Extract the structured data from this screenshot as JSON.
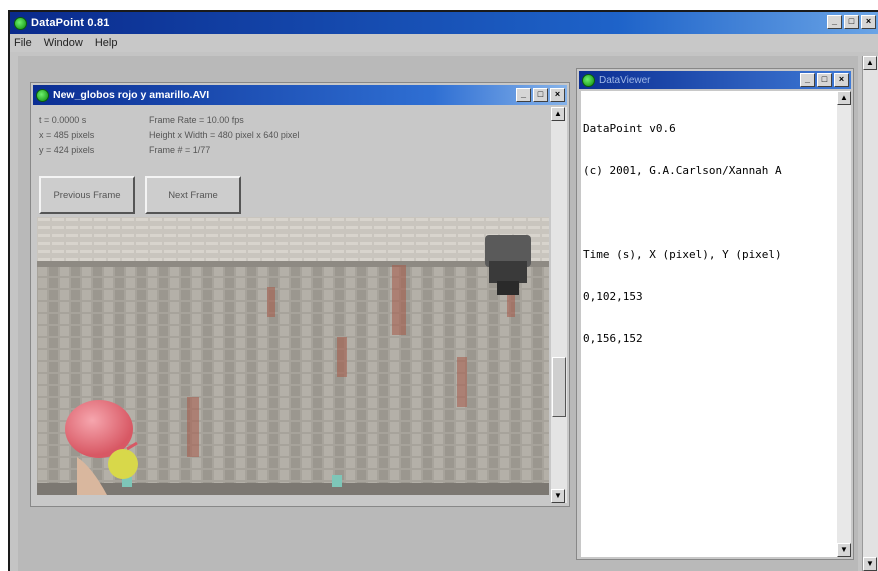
{
  "app": {
    "title": "DataPoint 0.81",
    "menu": [
      "File",
      "Window",
      "Help"
    ],
    "controls": {
      "minimize": "_",
      "maximize": "□",
      "close": "×"
    }
  },
  "video_window": {
    "title": "New_globos rojo y amarillo.AVI",
    "info_left": [
      "t = 0.0000 s",
      "x = 485 pixels",
      "y = 424 pixels"
    ],
    "info_right": [
      "Frame Rate = 10.00 fps",
      "Height x Width = 480 pixel x 640 pixel",
      "Frame # = 1/77"
    ],
    "buttons": {
      "previous": "Previous Frame",
      "next": "Next Frame"
    }
  },
  "data_viewer": {
    "title": "DataViewer",
    "lines": [
      "DataPoint v0.6",
      "(c) 2001, G.A.Carlson/Xannah A",
      "",
      "Time (s), X (pixel), Y (pixel)",
      "0,102,153",
      "0,156,152"
    ]
  },
  "colors": {
    "title_bar": "#0a2a8c",
    "window_bg": "#c8c8c8",
    "balloon_red": "#e8707a",
    "balloon_yellow": "#d8d84a"
  }
}
